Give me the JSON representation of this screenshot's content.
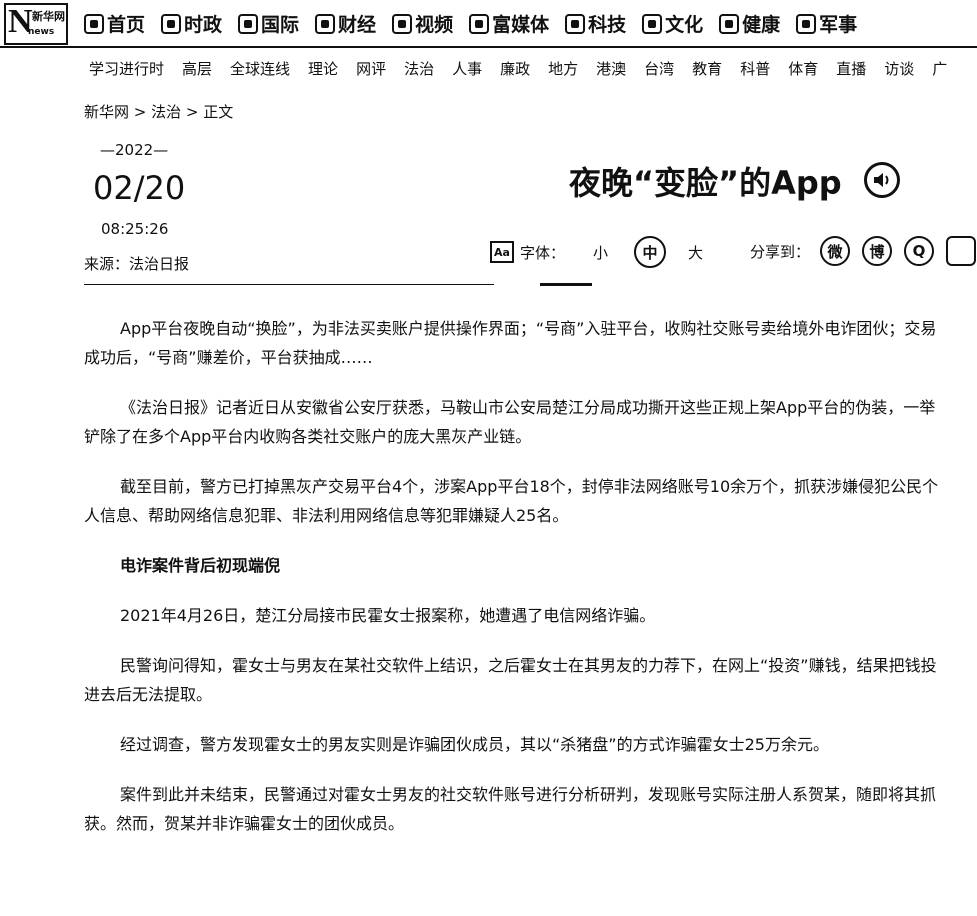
{
  "logo": {
    "mark": "N",
    "text": "新华网",
    "sub": "news"
  },
  "main_nav": [
    {
      "label": "首页",
      "icon": "home-icon"
    },
    {
      "label": "时政",
      "icon": "politics-icon"
    },
    {
      "label": "国际",
      "icon": "globe-icon"
    },
    {
      "label": "财经",
      "icon": "chart-icon"
    },
    {
      "label": "视频",
      "icon": "video-icon"
    },
    {
      "label": "富媒体",
      "icon": "media-icon"
    },
    {
      "label": "科技",
      "icon": "science-icon"
    },
    {
      "label": "文化",
      "icon": "culture-icon"
    },
    {
      "label": "健康",
      "icon": "health-icon"
    },
    {
      "label": "军事",
      "icon": "military-icon"
    }
  ],
  "sub_nav": [
    "学习进行时",
    "高层",
    "全球连线",
    "理论",
    "网评",
    "法治",
    "人事",
    "廉政",
    "地方",
    "港澳",
    "台湾",
    "教育",
    "科普",
    "体育",
    "直播",
    "访谈",
    "广"
  ],
  "breadcrumb": {
    "home": "新华网",
    "sep1": " > ",
    "section": "法治",
    "sep2": " > ",
    "current": "正文"
  },
  "article": {
    "year": "—2022—",
    "date": "02/20",
    "time": "08:25:26",
    "source": "来源：法治日报",
    "title": "夜晚“变脸”的App",
    "paragraphs": [
      {
        "text": "App平台夜晚自动“换脸”，为非法买卖账户提供操作界面；“号商”入驻平台，收购社交账号卖给境外电诈团伙；交易成功后，“号商”赚差价，平台获抽成……",
        "bold": false
      },
      {
        "text": "《法治日报》记者近日从安徽省公安厅获悉，马鞍山市公安局楚江分局成功撕开这些正规上架App平台的伪装，一举铲除了在多个App平台内收购各类社交账户的庞大黑灰产业链。",
        "bold": false
      },
      {
        "text": "截至目前，警方已打掉黑灰产交易平台4个，涉案App平台18个，封停非法网络账号10余万个，抓获涉嫌侵犯公民个人信息、帮助网络信息犯罪、非法利用网络信息等犯罪嫌疑人25名。",
        "bold": false
      },
      {
        "text": "电诈案件背后初现端倪",
        "bold": true
      },
      {
        "text": "2021年4月26日，楚江分局接市民霍女士报案称，她遭遇了电信网络诈骗。",
        "bold": false
      },
      {
        "text": "民警询问得知，霍女士与男友在某社交软件上结识，之后霍女士在其男友的力荐下，在网上“投资”赚钱，结果把钱投进去后无法提取。",
        "bold": false
      },
      {
        "text": "经过调查，警方发现霍女士的男友实则是诈骗团伙成员，其以“杀猪盘”的方式诈骗霍女士25万余元。",
        "bold": false
      },
      {
        "text": "案件到此并未结束，民警通过对霍女士男友的社交软件账号进行分析研判，发现账号实际注册人系贺某，随即将其抓获。然而，贺某并非诈骗霍女士的团伙成员。",
        "bold": false
      }
    ]
  },
  "font_tools": {
    "icon_text": "Aa",
    "label": "字体：",
    "small": "小",
    "medium": "中",
    "large": "大"
  },
  "share": {
    "label": "分享到：",
    "targets": [
      {
        "icon": "wechat-icon",
        "glyph": "微"
      },
      {
        "icon": "weibo-icon",
        "glyph": "博"
      },
      {
        "icon": "qzone-icon",
        "glyph": "Q"
      },
      {
        "icon": "mobile-icon",
        "glyph": ""
      }
    ]
  }
}
